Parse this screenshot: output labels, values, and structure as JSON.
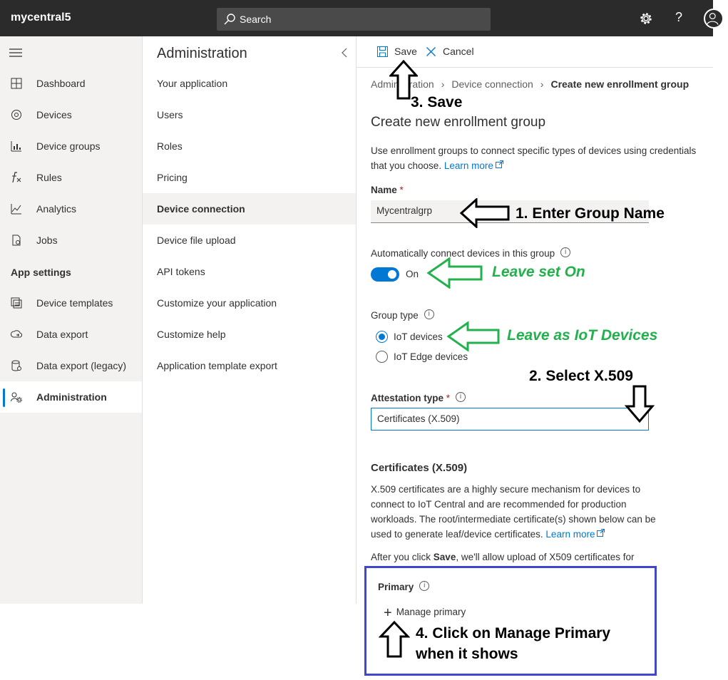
{
  "topbar": {
    "brand": "mycentral5",
    "search_placeholder": "Search"
  },
  "leftnav": {
    "items": [
      {
        "label": "Dashboard",
        "icon": "dashboard-icon"
      },
      {
        "label": "Devices",
        "icon": "devices-icon"
      },
      {
        "label": "Device groups",
        "icon": "device-groups-icon"
      },
      {
        "label": "Rules",
        "icon": "rules-icon"
      },
      {
        "label": "Analytics",
        "icon": "analytics-icon"
      },
      {
        "label": "Jobs",
        "icon": "jobs-icon"
      }
    ],
    "section_label": "App settings",
    "settings_items": [
      {
        "label": "Device templates",
        "icon": "device-templates-icon"
      },
      {
        "label": "Data export",
        "icon": "data-export-icon"
      },
      {
        "label": "Data export (legacy)",
        "icon": "data-export-legacy-icon"
      },
      {
        "label": "Administration",
        "icon": "administration-icon"
      }
    ]
  },
  "subnav": {
    "title": "Administration",
    "items": [
      "Your application",
      "Users",
      "Roles",
      "Pricing",
      "Device connection",
      "Device file upload",
      "API tokens",
      "Customize your application",
      "Customize help",
      "Application template export"
    ],
    "active": "Device connection"
  },
  "commandbar": {
    "save": "Save",
    "cancel": "Cancel"
  },
  "breadcrumb": {
    "items": [
      "Administration",
      "Device connection",
      "Create new enrollment group"
    ]
  },
  "form": {
    "title": "Create new enrollment group",
    "intro": "Use enrollment groups to connect specific types of devices using credentials that you choose.",
    "learn_more": "Learn more",
    "name_label": "Name",
    "required_mark": "*",
    "name_value": "Mycentralgrp",
    "auto_connect_label": "Automatically connect devices in this group",
    "auto_connect_state": "On",
    "group_type_label": "Group type",
    "group_type_options": [
      "IoT devices",
      "IoT Edge devices"
    ],
    "group_type_selected": "IoT devices",
    "attestation_label": "Attestation type",
    "attestation_value": "Certificates (X.509)",
    "cert_heading": "Certificates (X.509)",
    "cert_description": "X.509 certificates are a highly secure mechanism for devices to connect to IoT Central and are recommended for production workloads. The root/intermediate certificate(s) shown below can be used to generate leaf/device certificates.",
    "cert_learn_more": "Learn more",
    "after_prefix": "After you click",
    "after_bold": "Save",
    "after_suffix": ", we'll allow upload of X509 certificates for",
    "primary_label": "Primary",
    "manage_primary": "Manage primary"
  },
  "annotations": {
    "step1": "1. Enter Group Name",
    "leave_on": "Leave set On",
    "leave_iot": "Leave as IoT Devices",
    "step2": "2. Select X.509",
    "step3": "3. Save",
    "step4_line1": "4. Click on Manage Primary",
    "step4_line2": "when it shows",
    "colors": {
      "black": "#000000",
      "green": "#22b14c",
      "box": "#3f48cc"
    }
  },
  "colors": {
    "accent": "#0078d4",
    "topbar": "#2b2b2b"
  }
}
